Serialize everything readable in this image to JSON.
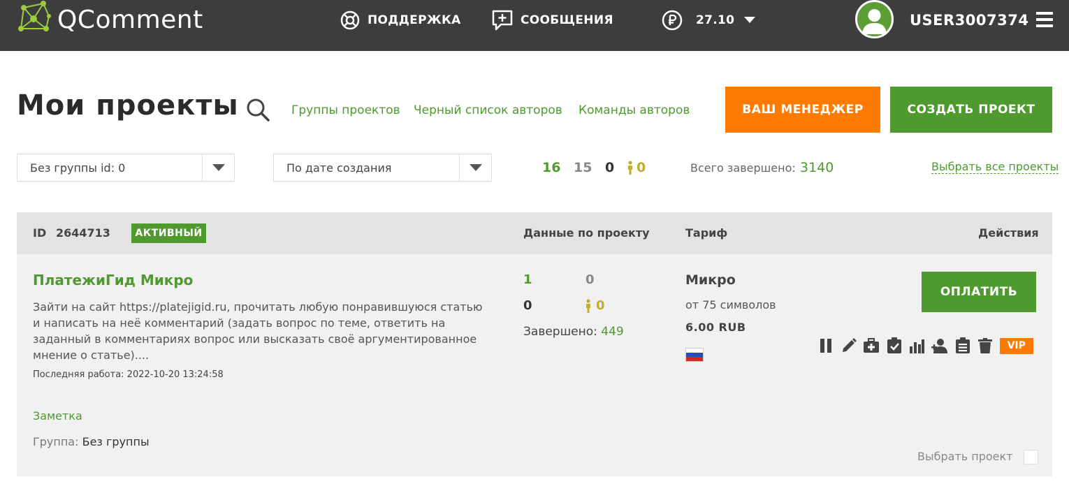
{
  "header": {
    "logo_text": "QComment",
    "support_label": "ПОДДЕРЖКА",
    "messages_label": "СООБЩЕНИЯ",
    "balance": "27.10",
    "username": "USER3007374"
  },
  "page": {
    "title": "Мои проекты",
    "links": [
      "Группы проектов",
      "Черный список авторов",
      "Команды авторов"
    ],
    "manager_button": "ВАШ МЕНЕДЖЕР",
    "create_button": "СОЗДАТЬ ПРОЕКТ"
  },
  "filters": {
    "group_select": "Без группы id: 0",
    "sort_select": "По дате создания",
    "stats": [
      "16",
      "15",
      "0",
      "0"
    ],
    "total_label": "Всего завершено:",
    "total_value": "3140",
    "select_all": "Выбрать все проекты"
  },
  "project": {
    "id_label": "ID",
    "id": "2644713",
    "status": "АКТИВНЫЙ",
    "col_data": "Данные по проекту",
    "col_tariff": "Тариф",
    "col_actions": "Действия",
    "title": "ПлатежиГид Микро",
    "description": "Зайти на сайт https://platejigid.ru, прочитать любую понравившуюся статью и написать на неё комментарий (задать вопрос по теме, ответить на заданный в комментариях вопрос или высказать своё аргументированное мнение о статье)....",
    "last_work": "Последняя работа: 2022-10-20 13:24:58",
    "note": "Заметка",
    "group_label": "Группа:",
    "group_value": "Без группы",
    "data": {
      "a": "1",
      "b": "0",
      "c": "0",
      "d": "0"
    },
    "done_label": "Завершено:",
    "done_value": "449",
    "tariff_name": "Микро",
    "tariff_sub": "от 75 символов",
    "tariff_price": "6.00 RUB",
    "pay_button": "ОПЛАТИТЬ",
    "vip_label": "VIP",
    "choose_label": "Выбрать проект"
  },
  "icons": [
    "pause-icon",
    "pencil-icon",
    "medkit-icon",
    "clipboard-check-icon",
    "bar-chart-icon",
    "add-user-icon",
    "clipboard-list-icon",
    "trash-icon"
  ],
  "colors": {
    "green": "#4e9a2e",
    "orange": "#ff7a00",
    "olive": "#bfae2c",
    "gray_stat": "#888888",
    "topbar": "#3d3d3d"
  }
}
